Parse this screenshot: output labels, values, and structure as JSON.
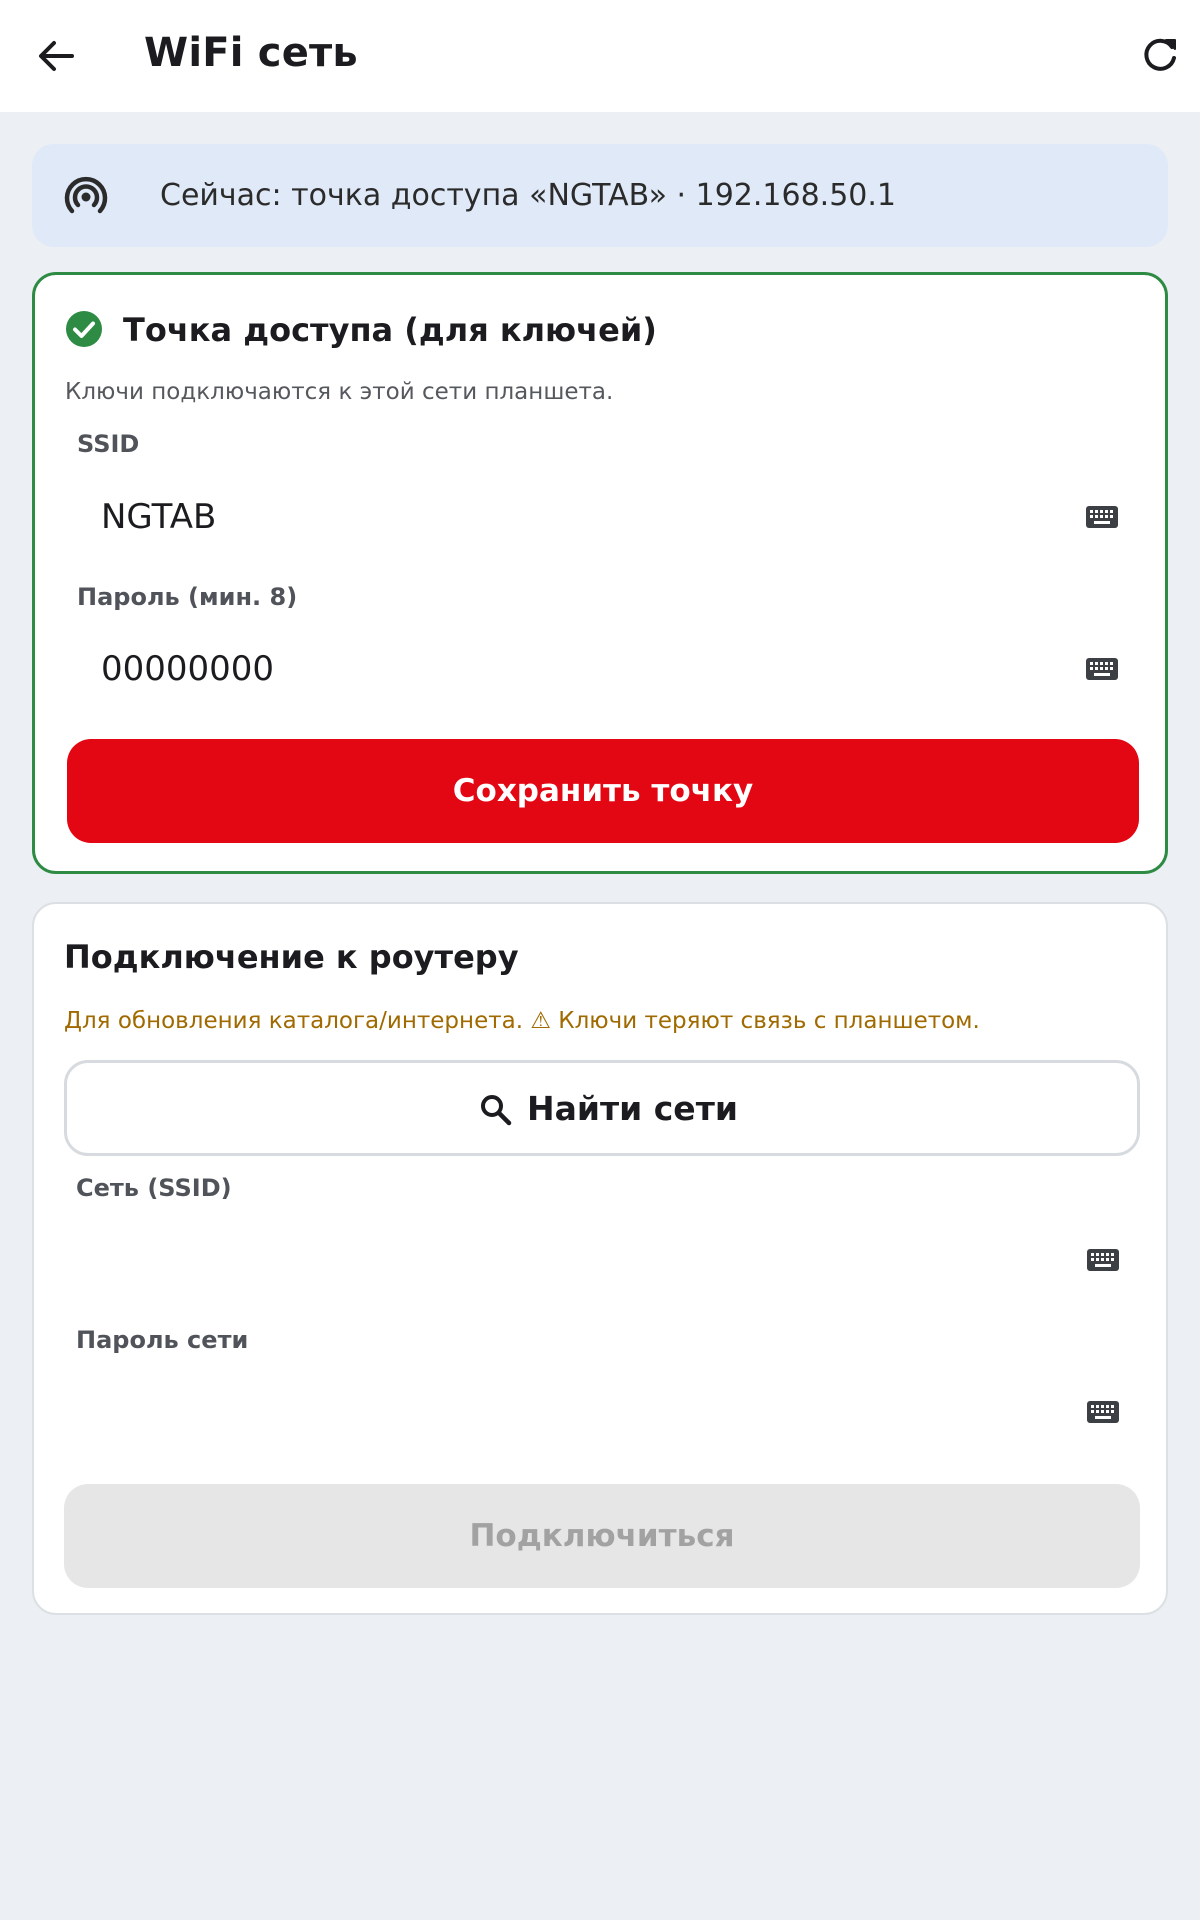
{
  "appbar": {
    "title": "WiFi сеть",
    "back_icon": "arrow-back-icon",
    "refresh_icon": "refresh-icon"
  },
  "status": {
    "icon": "hotspot-icon",
    "text": "Сейчас: точка доступа «NGTAB» · 192.168.50.1"
  },
  "hotspot": {
    "title": "Точка доступа (для ключей)",
    "description": "Ключи подключаются к этой сети планшета.",
    "ssid_label": "SSID",
    "ssid_value": "NGTAB",
    "password_label": "Пароль (мин. 8)",
    "password_value": "00000000",
    "save_label": "Сохранить точку",
    "border_color": "#2e8b43",
    "accent_color": "#e30613"
  },
  "router": {
    "title": "Подключение к роутеру",
    "warning": "Для обновления каталога/интернета. ⚠ Ключи теряют связь с планшетом.",
    "search_label": "Найти сети",
    "network_label": "Сеть (SSID)",
    "network_value": "",
    "password_label": "Пароль сети",
    "password_value": "",
    "connect_label": "Подключиться"
  }
}
